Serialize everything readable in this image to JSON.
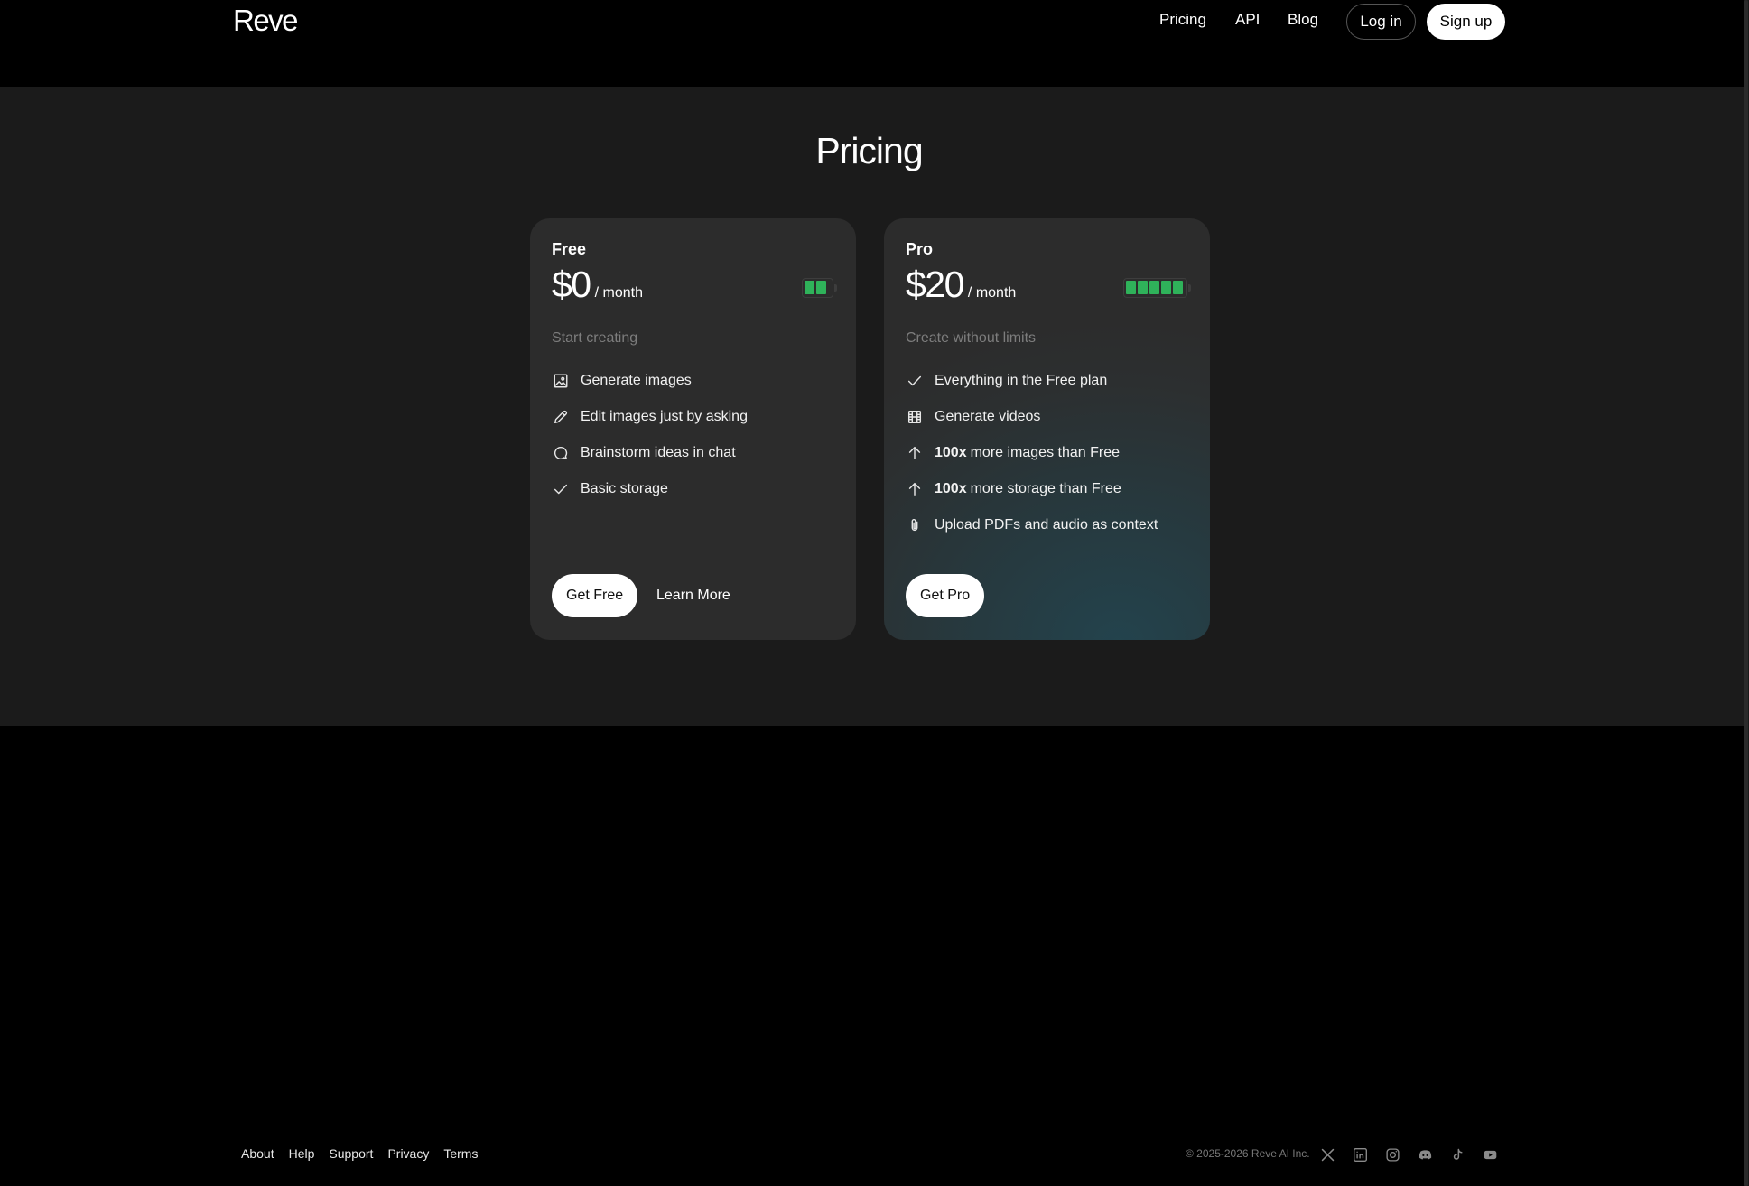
{
  "header": {
    "logo": "Reve",
    "nav": [
      "Pricing",
      "API",
      "Blog"
    ],
    "login_label": "Log in",
    "signup_label": "Sign up"
  },
  "page_title": "Pricing",
  "plans": [
    {
      "name": "Free",
      "price": "$0",
      "period": "/ month",
      "battery_level": 2,
      "tagline": "Start creating",
      "features": [
        {
          "icon": "image-icon",
          "text": "Generate images"
        },
        {
          "icon": "pencil-icon",
          "text": "Edit images just by asking"
        },
        {
          "icon": "chat-icon",
          "text": "Brainstorm ideas in chat"
        },
        {
          "icon": "check-icon",
          "text": "Basic storage"
        }
      ],
      "cta_label": "Get Free",
      "secondary_label": "Learn More"
    },
    {
      "name": "Pro",
      "price": "$20",
      "period": "/ month",
      "battery_level": 5,
      "tagline": "Create without limits",
      "features": [
        {
          "icon": "check-icon",
          "text": "Everything in the Free plan"
        },
        {
          "icon": "film-icon",
          "text": "Generate videos"
        },
        {
          "icon": "arrow-up-icon",
          "bold": "100x",
          "text": "more images than Free"
        },
        {
          "icon": "arrow-up-icon",
          "bold": "100x",
          "text": "more storage than Free"
        },
        {
          "icon": "paperclip-icon",
          "text": "Upload PDFs and audio as context"
        }
      ],
      "cta_label": "Get Pro"
    }
  ],
  "footer": {
    "links": [
      "About",
      "Help",
      "Support",
      "Privacy",
      "Terms"
    ],
    "copyright": "© 2025-2026 Reve AI Inc.",
    "socials": [
      "x-icon",
      "linkedin-icon",
      "instagram-icon",
      "discord-icon",
      "tiktok-icon",
      "youtube-icon"
    ]
  },
  "colors": {
    "battery_fill": "#2fb25a",
    "section_bg": "#1b1b1b",
    "card_bg": "#2c2c2c"
  }
}
